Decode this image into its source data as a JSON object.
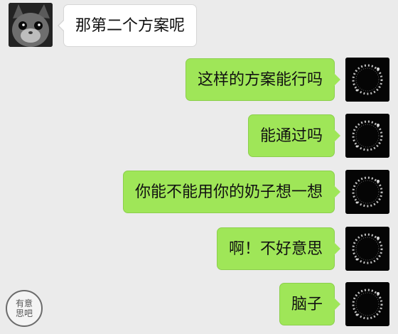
{
  "chat": {
    "incoming": {
      "avatar_icon": "cat-avatar-icon",
      "text": "那第二个方案呢"
    },
    "outgoing": [
      {
        "text": "这样的方案能行吗",
        "avatar_icon": "wreath-avatar-icon"
      },
      {
        "text": "能通过吗",
        "avatar_icon": "wreath-avatar-icon"
      },
      {
        "text": "你能不能用你的奶子想一想",
        "avatar_icon": "wreath-avatar-icon"
      },
      {
        "text": "啊！不好意思",
        "avatar_icon": "wreath-avatar-icon"
      },
      {
        "text": "脑子",
        "avatar_icon": "wreath-avatar-icon"
      }
    ]
  },
  "watermark": {
    "line1": "有意",
    "line2": "思吧"
  },
  "colors": {
    "background": "#ebebeb",
    "outgoing_bubble": "#9fe658",
    "incoming_bubble": "#ffffff"
  }
}
